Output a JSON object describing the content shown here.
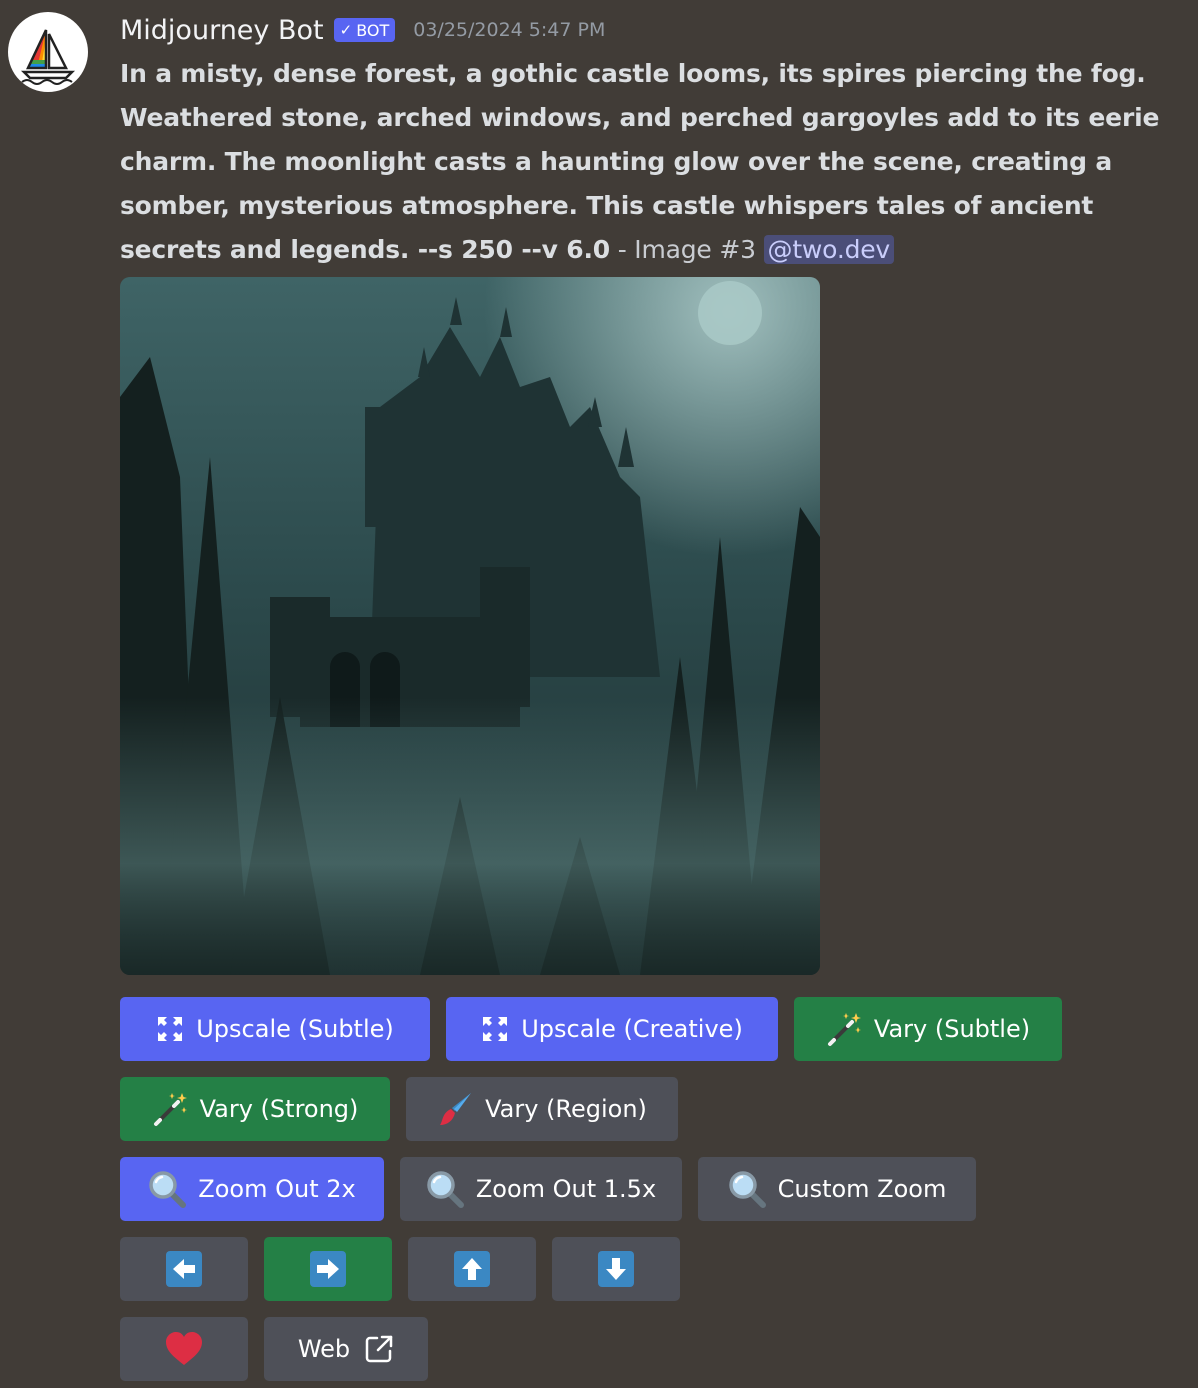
{
  "author": {
    "name": "Midjourney Bot",
    "badge": "BOT",
    "timestamp": "03/25/2024 5:47 PM"
  },
  "message": {
    "prompt": "In a misty, dense forest, a gothic castle looms, its spires piercing the fog. Weathered stone, arched windows, and perched gargoyles add to its eerie charm. The moonlight casts a haunting glow over the scene, creating a somber, mysterious atmosphere. This castle whispers tales of ancient secrets and legends. --s 250 --v 6.0",
    "suffix": " - Image #3 ",
    "mention": "@two.dev"
  },
  "buttons": {
    "upscale_subtle": "Upscale (Subtle)",
    "upscale_creative": "Upscale (Creative)",
    "vary_subtle": "Vary (Subtle)",
    "vary_strong": "Vary (Strong)",
    "vary_region": "Vary (Region)",
    "zoom_out_2x": "Zoom Out 2x",
    "zoom_out_15x": "Zoom Out 1.5x",
    "custom_zoom": "Custom Zoom",
    "web": "Web"
  },
  "icons": {
    "upscale": "expand-icon",
    "vary": "magic-wand-icon",
    "region": "paintbrush-icon",
    "zoom": "magnifier-icon",
    "pan": [
      "arrow-left-icon",
      "arrow-right-icon",
      "arrow-up-icon",
      "arrow-down-icon"
    ],
    "favorite": "heart-icon",
    "external": "external-link-icon"
  },
  "colors": {
    "background": "#413c37",
    "blurple": "#5865f2",
    "green": "#248046",
    "grey": "#4e5058"
  }
}
